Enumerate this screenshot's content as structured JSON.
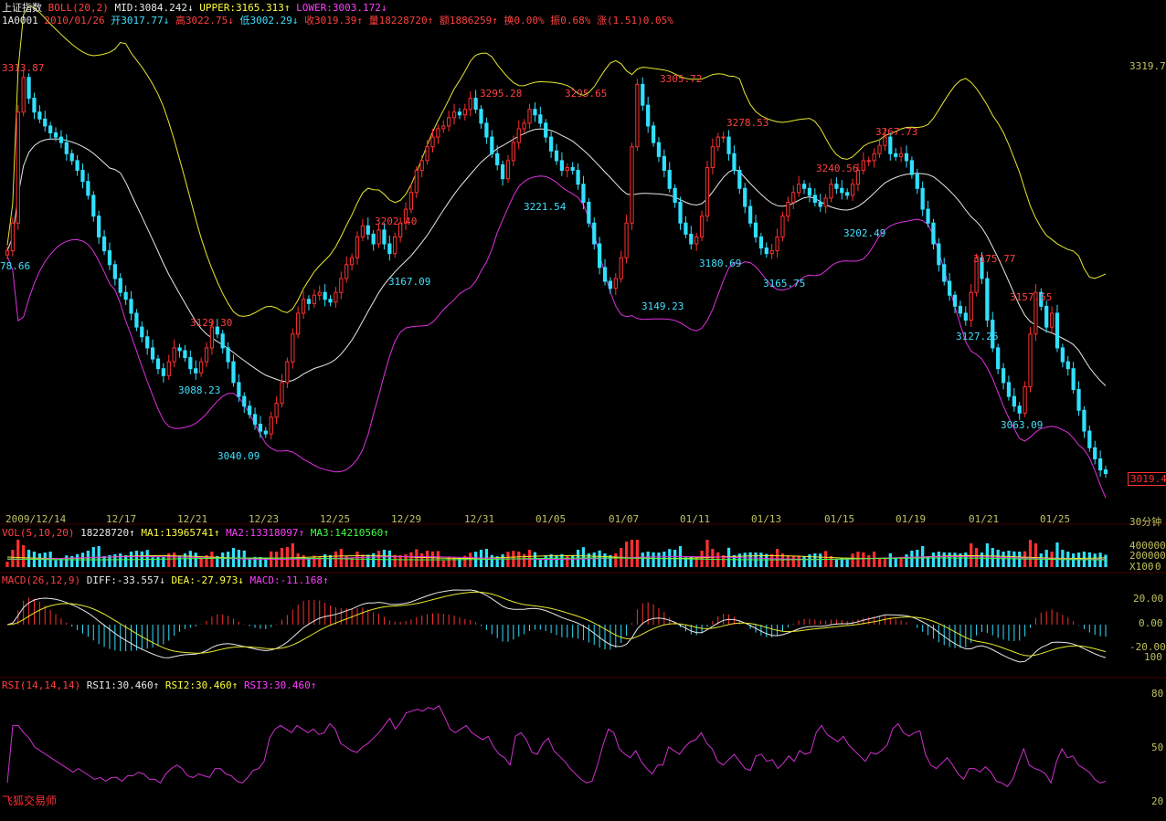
{
  "header": {
    "index_name": "上证指数",
    "boll_label": "BOLL(20,2)",
    "mid": "MID:3084.242↓",
    "upper": "UPPER:3165.313↑",
    "lower": "LOWER:3003.172↓"
  },
  "quote": {
    "code": "1A0001",
    "date": "2010/01/26",
    "open": "开3017.77↓",
    "high": "高3022.75↓",
    "low": "低3002.29↓",
    "close": "收3019.39↑",
    "volume": "量18228720↑",
    "amount": "额1886259↑",
    "turnover": "换0.00%",
    "amplitude": "振0.68%",
    "change": "涨(1.51)0.05%"
  },
  "price_axis": {
    "top_label": "3319.7",
    "current_tag": "3019.4",
    "period_label": "30分钟"
  },
  "volume_panel": {
    "label": "VOL(5,10,20)",
    "value": "18228720↑",
    "ma1": "MA1:13965741↑",
    "ma2": "MA2:13318097↑",
    "ma3": "MA3:14210560↑",
    "axis": [
      "400000",
      "200000",
      "X100",
      "0"
    ]
  },
  "macd_panel": {
    "label": "MACD(26,12,9)",
    "diff": "DIFF:-33.557↓",
    "dea": "DEA:-27.973↓",
    "macd": "MACD:-11.168↑",
    "axis": [
      "20.00",
      "0.00",
      "-20.00",
      "100"
    ]
  },
  "rsi_panel": {
    "label": "RSI(14,14,14)",
    "rsi1": "RSI1:30.460↑",
    "rsi2": "RSI2:30.460↑",
    "rsi3": "RSI3:30.460↑",
    "axis": [
      "80",
      "50",
      "20"
    ]
  },
  "watermark": "飞狐交易师",
  "colors": {
    "up": "#ff3030",
    "down": "#30e0ff",
    "mid": "#e8e8e8",
    "upper": "#e8e830",
    "lower": "#e030e0",
    "rsi": "#d030d0"
  },
  "chart_data": {
    "type": "candlestick",
    "x_axis_labels": [
      "2009/12/14",
      "12/17",
      "12/21",
      "12/23",
      "12/25",
      "12/29",
      "12/31",
      "01/05",
      "01/07",
      "01/11",
      "01/13",
      "01/15",
      "01/19",
      "01/21",
      "01/25"
    ],
    "price_range": [
      3000,
      3320
    ],
    "peak_annotations": [
      "3313.87",
      "3129.30",
      "3202.40",
      "3295.28",
      "3295.65",
      "3305.72",
      "3278.53",
      "3240.56",
      "3267.73",
      "3175.77",
      "3157.65"
    ],
    "trough_annotations": [
      "78.66",
      "3088.23",
      "3040.09",
      "3167.09",
      "3221.54",
      "3149.23",
      "3180.69",
      "3165.75",
      "3202.49",
      "3127.26",
      "3063.09"
    ],
    "close_series": [
      3180,
      3200,
      3280,
      3305,
      3290,
      3280,
      3275,
      3270,
      3265,
      3262,
      3258,
      3250,
      3245,
      3238,
      3230,
      3220,
      3205,
      3190,
      3180,
      3170,
      3160,
      3150,
      3145,
      3135,
      3125,
      3118,
      3110,
      3102,
      3095,
      3090,
      3100,
      3110,
      3108,
      3103,
      3095,
      3092,
      3100,
      3110,
      3125,
      3120,
      3110,
      3100,
      3085,
      3075,
      3068,
      3062,
      3055,
      3050,
      3048,
      3060,
      3070,
      3085,
      3100,
      3120,
      3135,
      3145,
      3142,
      3148,
      3150,
      3145,
      3143,
      3150,
      3160,
      3170,
      3175,
      3190,
      3198,
      3192,
      3185,
      3195,
      3185,
      3178,
      3190,
      3200,
      3210,
      3222,
      3238,
      3245,
      3255,
      3262,
      3268,
      3270,
      3276,
      3280,
      3278,
      3282,
      3290,
      3282,
      3272,
      3262,
      3250,
      3242,
      3232,
      3245,
      3258,
      3268,
      3272,
      3282,
      3278,
      3272,
      3262,
      3252,
      3245,
      3238,
      3240,
      3238,
      3228,
      3215,
      3200,
      3185,
      3168,
      3158,
      3153,
      3160,
      3175,
      3200,
      3255,
      3300,
      3285,
      3270,
      3258,
      3248,
      3238,
      3225,
      3215,
      3200,
      3192,
      3185,
      3190,
      3205,
      3240,
      3255,
      3262,
      3262,
      3250,
      3238,
      3225,
      3212,
      3200,
      3190,
      3182,
      3178,
      3180,
      3190,
      3205,
      3215,
      3222,
      3228,
      3225,
      3220,
      3215,
      3212,
      3218,
      3228,
      3225,
      3222,
      3220,
      3228,
      3238,
      3245,
      3245,
      3250,
      3256,
      3262,
      3250,
      3248,
      3250,
      3245,
      3235,
      3225,
      3210,
      3200,
      3185,
      3170,
      3158,
      3148,
      3140,
      3135,
      3130,
      3150,
      3175,
      3160,
      3130,
      3110,
      3095,
      3085,
      3075,
      3068,
      3063,
      3082,
      3120,
      3150,
      3140,
      3125,
      3135,
      3110,
      3100,
      3095,
      3080,
      3065,
      3050,
      3038,
      3030,
      3022,
      3019.39
    ],
    "rsi_series": [
      30,
      62,
      62,
      58,
      55,
      50,
      48,
      46,
      44,
      42,
      40,
      38,
      36,
      38,
      36,
      34,
      32,
      33,
      31,
      33,
      33,
      31,
      34,
      34,
      36,
      35,
      32,
      32,
      30,
      35,
      38,
      40,
      38,
      34,
      33,
      35,
      34,
      33,
      38,
      38,
      35,
      34,
      31,
      30,
      33,
      37,
      38,
      42,
      55,
      60,
      62,
      60,
      58,
      62,
      60,
      58,
      60,
      57,
      58,
      63,
      60,
      52,
      50,
      48,
      47,
      50,
      52,
      55,
      58,
      62,
      66,
      60,
      64,
      69,
      70,
      71,
      70,
      72,
      71,
      73,
      67,
      60,
      58,
      60,
      62,
      58,
      56,
      54,
      56,
      50,
      46,
      44,
      40,
      56,
      58,
      54,
      47,
      46,
      52,
      55,
      48,
      45,
      42,
      38,
      35,
      32,
      30,
      31,
      40,
      51,
      60,
      58,
      49,
      46,
      44,
      48,
      42,
      38,
      35,
      40,
      40,
      50,
      48,
      46,
      50,
      53,
      54,
      58,
      52,
      49,
      42,
      40,
      43,
      46,
      42,
      38,
      37,
      45,
      46,
      42,
      43,
      38,
      41,
      45,
      42,
      48,
      46,
      47,
      58,
      62,
      57,
      55,
      53,
      56,
      51,
      48,
      45,
      42,
      47,
      46,
      48,
      51,
      60,
      63,
      58,
      56,
      58,
      59,
      46,
      40,
      38,
      41,
      44,
      40,
      35,
      32,
      38,
      38,
      36,
      39,
      36,
      31,
      30,
      28,
      32,
      41,
      49,
      40,
      38,
      37,
      35,
      30,
      42,
      49,
      44,
      45,
      40,
      38,
      36,
      32,
      30,
      31
    ],
    "rsi_range": [
      20,
      80
    ]
  }
}
